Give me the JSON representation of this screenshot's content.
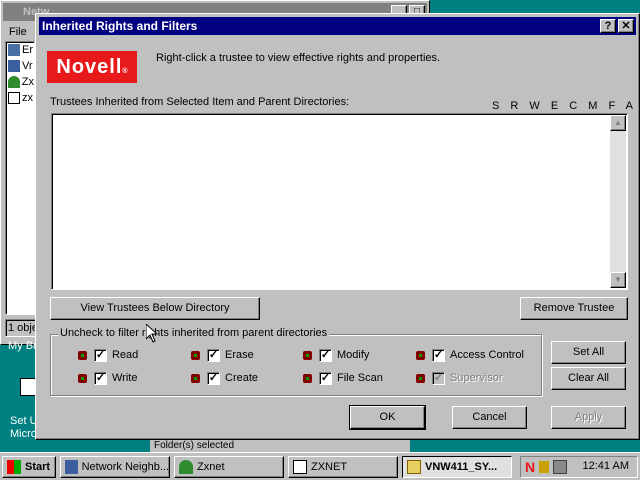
{
  "background_window": {
    "title": "Netw",
    "menu": [
      "File"
    ],
    "items": [
      "Er",
      "Vr",
      "Zx",
      "zx"
    ],
    "status": "1 obje"
  },
  "desktop": {
    "label_mybriefcase": "My Br",
    "label_setup": "Set U",
    "label_micro": "Micro",
    "behind_text": "Folder(s) selected"
  },
  "dialog": {
    "title": "Inherited Rights and Filters",
    "help_glyph": "?",
    "close_glyph": "✕",
    "logo_text": "Novell",
    "logo_mark": "®",
    "hint": "Right-click a trustee to view effective rights and properties.",
    "list_label": "Trustees Inherited from Selected Item and Parent Directories:",
    "rights_columns": "S R W E C M F A",
    "view_trustees_button": "View Trustees Below Directory",
    "remove_trustee_button": "Remove Trustee",
    "filter_group_label": "Uncheck to filter rights inherited from parent directories",
    "filters": [
      {
        "label": "Read",
        "checked": true,
        "enabled": true
      },
      {
        "label": "Write",
        "checked": true,
        "enabled": true
      },
      {
        "label": "Erase",
        "checked": true,
        "enabled": true
      },
      {
        "label": "Create",
        "checked": true,
        "enabled": true
      },
      {
        "label": "Modify",
        "checked": true,
        "enabled": true
      },
      {
        "label": "File Scan",
        "checked": true,
        "enabled": true
      },
      {
        "label": "Access Control",
        "checked": true,
        "enabled": true
      },
      {
        "label": "Supervisor",
        "checked": true,
        "enabled": false
      }
    ],
    "set_all_button": "Set All",
    "clear_all_button": "Clear All",
    "ok_button": "OK",
    "cancel_button": "Cancel",
    "apply_button": "Apply"
  },
  "taskbar": {
    "start": "Start",
    "tasks": [
      "Network Neighb...",
      "Zxnet",
      "ZXNET",
      "VNW411_SY..."
    ],
    "clock": "12:41 AM"
  },
  "colors": {
    "desktop": "#008080",
    "title_active": "#000080",
    "title_inactive": "#808080",
    "novell_red": "#e8191b"
  }
}
